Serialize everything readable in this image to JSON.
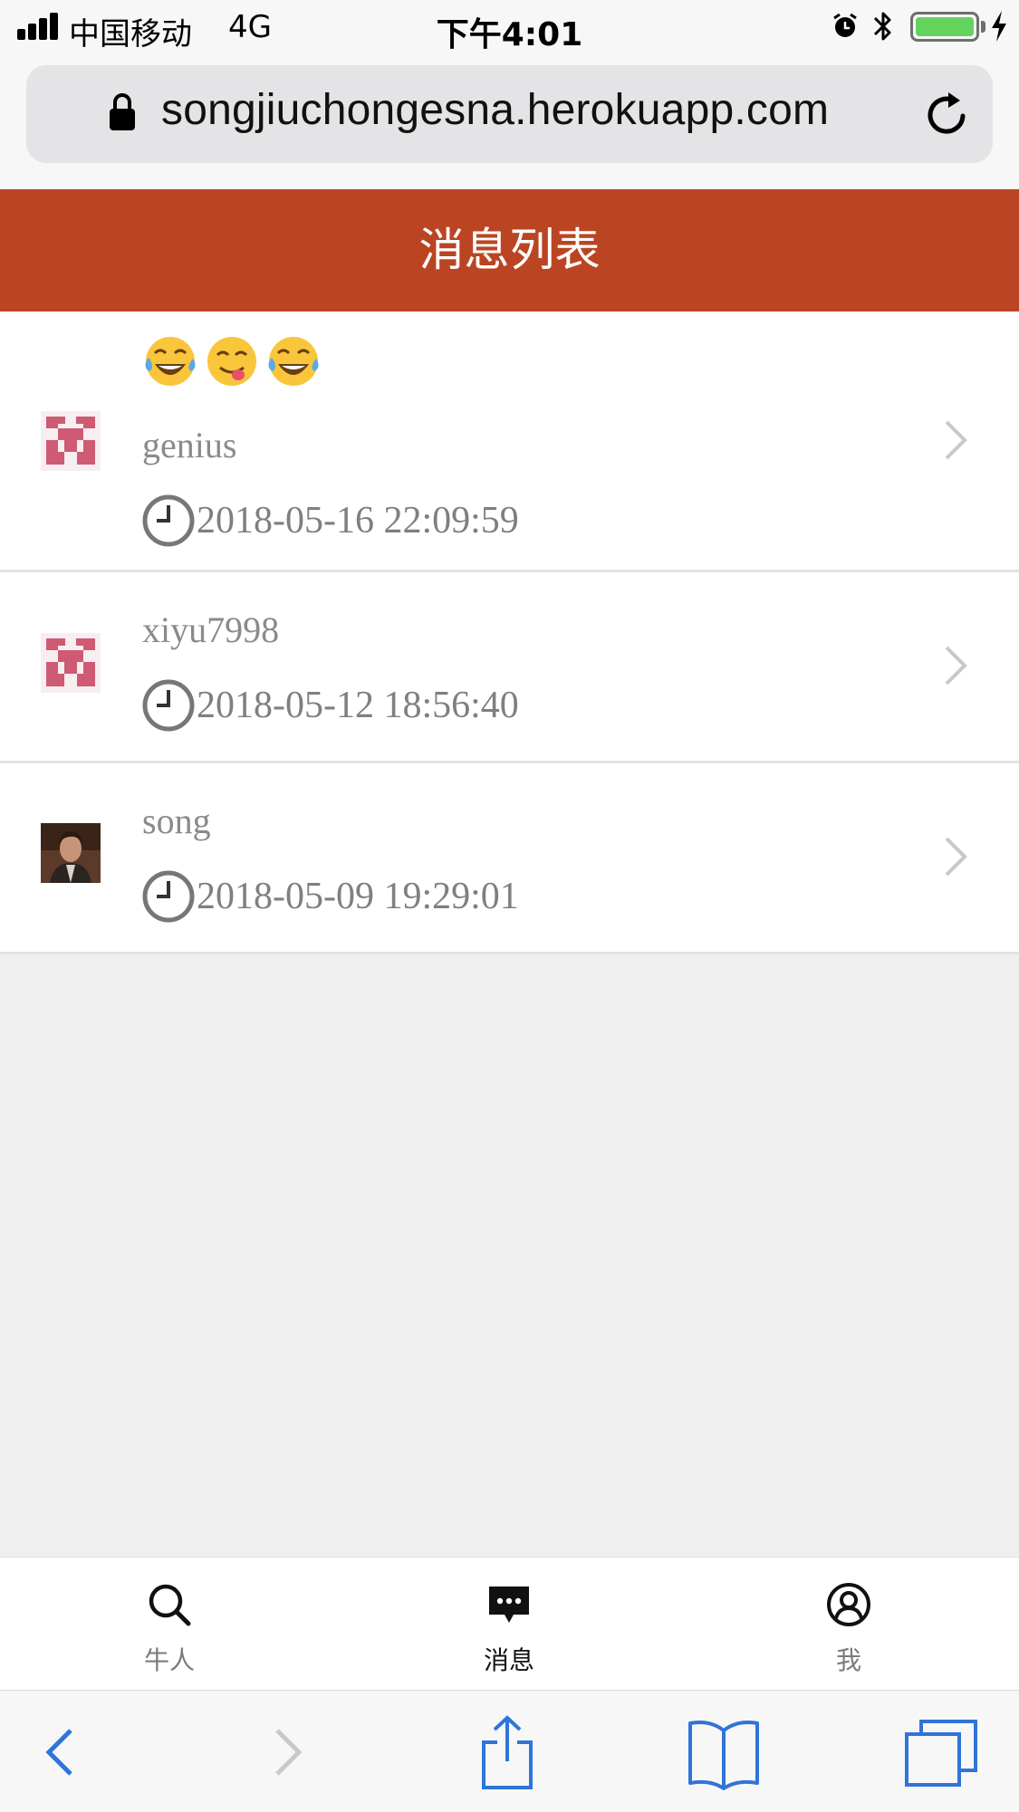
{
  "status_bar": {
    "carrier": "中国移动",
    "network": "4G",
    "time": "下午4:01",
    "battery_level": 1.0
  },
  "browser": {
    "url": "songjiuchongesna.herokuapp.com"
  },
  "header": {
    "title": "消息列表"
  },
  "messages": [
    {
      "emojis": [
        "tears-of-joy",
        "yum",
        "tears-of-joy"
      ],
      "name": "genius",
      "time": "2018-05-16 22:09:59",
      "avatar": "pink-identicon"
    },
    {
      "name": "xiyu7998",
      "time": "2018-05-12 18:56:40",
      "avatar": "pink-identicon"
    },
    {
      "name": "song",
      "time": "2018-05-09 19:29:01",
      "avatar": "photo-portrait"
    }
  ],
  "tabs": [
    {
      "label": "牛人",
      "icon": "search-icon"
    },
    {
      "label": "消息",
      "icon": "chat-bubble-icon",
      "active": true
    },
    {
      "label": "我",
      "icon": "user-icon"
    }
  ],
  "colors": {
    "header": "#bb4522",
    "toolbar_icons": "#2f74d8",
    "battery": "#64d35e"
  }
}
